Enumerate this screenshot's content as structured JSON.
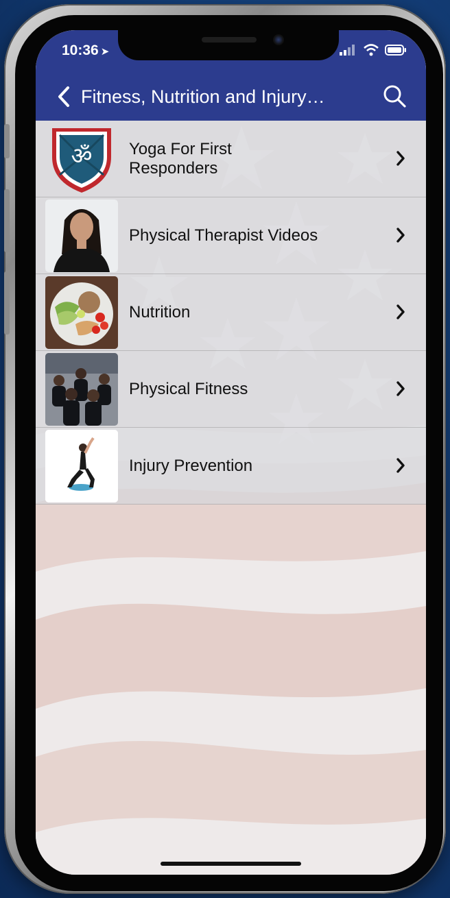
{
  "status_bar": {
    "time": "10:36",
    "location_glyph": "➤"
  },
  "nav": {
    "title": "Fitness, Nutrition and Injury…",
    "back_icon": "chevron-left-icon",
    "search_icon": "search-icon"
  },
  "list": {
    "items": [
      {
        "label": "Yoga For First Responders",
        "thumb": "yoga-shield-logo"
      },
      {
        "label": "Physical Therapist Videos",
        "thumb": "therapist-portrait"
      },
      {
        "label": "Nutrition",
        "thumb": "salad-bowl"
      },
      {
        "label": "Physical Fitness",
        "thumb": "officers-running"
      },
      {
        "label": "Injury Prevention",
        "thumb": "lunge-exercise"
      }
    ]
  },
  "colors": {
    "nav_bar": "#2c3c8e",
    "row_bg": "#d6d6da",
    "flag_stripe": "#e2cfca"
  }
}
